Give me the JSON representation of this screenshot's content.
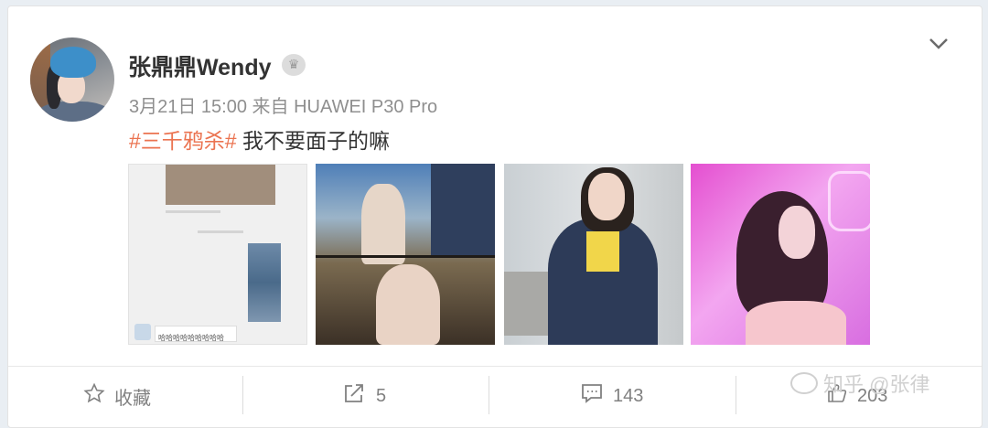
{
  "post": {
    "username": "张鼎鼎Wendy",
    "meta": "3月21日 15:00 来自 HUAWEI P30 Pro",
    "hashtag": "#三千鸦杀#",
    "text": " 我不要面子的嘛"
  },
  "thumbnails": [
    {
      "caption": "哈哈哈哈哈哈哈哈哈"
    },
    {
      "caption": ""
    },
    {
      "caption": ""
    },
    {
      "caption": ""
    }
  ],
  "actions": {
    "favorite": {
      "label": "收藏",
      "icon": "star-icon"
    },
    "repost": {
      "count": "5",
      "icon": "share-icon"
    },
    "comment": {
      "count": "143",
      "icon": "comment-icon"
    },
    "like": {
      "count": "203",
      "icon": "thumb-icon"
    }
  },
  "watermark": "知乎 @张律",
  "colors": {
    "hashtag": "#eb7350",
    "text": "#333333",
    "meta": "#8f8f8f"
  }
}
